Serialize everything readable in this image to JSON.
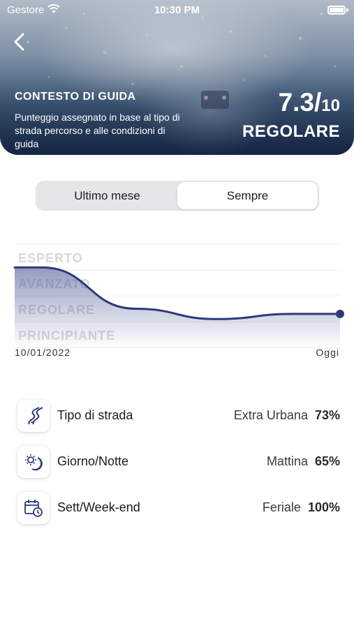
{
  "status_bar": {
    "carrier": "Gestore",
    "time": "10:30 PM"
  },
  "header": {
    "title": "CONTESTO DI GUIDA",
    "description": "Punteggio assegnato in base al tipo di strada percorso e alle condizioni di guida",
    "score": "7.3/",
    "score_max": "10",
    "level": "REGOLARE"
  },
  "segmented": {
    "options": [
      "Ultimo mese",
      "Sempre"
    ],
    "selected": "Sempre"
  },
  "chart_data": {
    "type": "area",
    "y_levels": [
      "ESPERTO",
      "AVANZATO",
      "REGOLARE",
      "PRINCIPIANTE"
    ],
    "x_labels": [
      "10/01/2022",
      "Oggi"
    ],
    "series": [
      {
        "values": [
          8.6,
          8.6,
          7.0,
          6.6,
          6.8,
          6.8
        ]
      }
    ],
    "line_color": "#2b3a7a"
  },
  "stats": [
    {
      "label": "Tipo di strada",
      "value": "Extra Urbana",
      "percent": "73%",
      "icon": "road-icon"
    },
    {
      "label": "Giorno/Notte",
      "value": "Mattina",
      "percent": "65%",
      "icon": "day-night-icon"
    },
    {
      "label": "Sett/Week-end",
      "value": "Feriale",
      "percent": "100%",
      "icon": "calendar-clock-icon"
    }
  ]
}
